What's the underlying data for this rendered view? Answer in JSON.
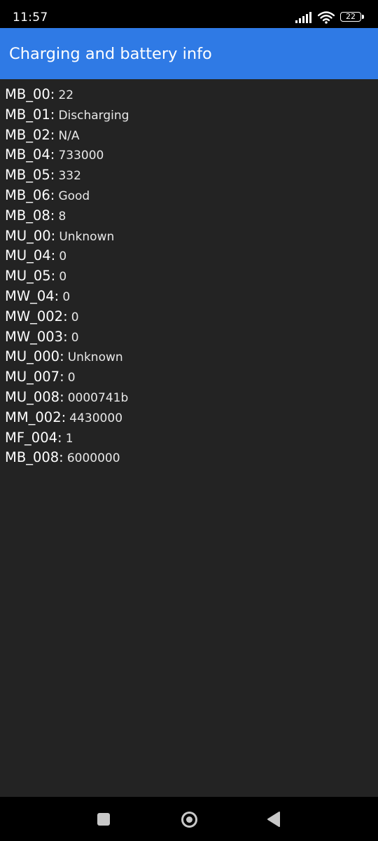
{
  "status_bar": {
    "time": "11:57",
    "battery_level": "22",
    "icons": [
      "signal-icon",
      "wifi-icon",
      "battery-icon"
    ]
  },
  "app_bar": {
    "title": "Charging and battery info",
    "color": "#2f7ae5"
  },
  "info": {
    "items": [
      {
        "key": "MB_00:",
        "value": "22"
      },
      {
        "key": "MB_01:",
        "value": "Discharging"
      },
      {
        "key": "MB_02:",
        "value": "N/A"
      },
      {
        "key": "MB_04:",
        "value": "733000"
      },
      {
        "key": "MB_05:",
        "value": "332"
      },
      {
        "key": "MB_06:",
        "value": "Good"
      },
      {
        "key": "MB_08:",
        "value": "8"
      },
      {
        "key": "MU_00:",
        "value": "Unknown"
      },
      {
        "key": "MU_04:",
        "value": "0"
      },
      {
        "key": "MU_05:",
        "value": "0"
      },
      {
        "key": "MW_04:",
        "value": "0"
      },
      {
        "key": "MW_002:",
        "value": "0"
      },
      {
        "key": "MW_003:",
        "value": "0"
      },
      {
        "key": "MU_000:",
        "value": "Unknown"
      },
      {
        "key": "MU_007:",
        "value": "0"
      },
      {
        "key": "MU_008:",
        "value": "0000741b"
      },
      {
        "key": "MM_002:",
        "value": "4430000"
      },
      {
        "key": "MF_004:",
        "value": "1"
      },
      {
        "key": "MB_008:",
        "value": "6000000"
      }
    ]
  },
  "nav_bar": {
    "buttons": [
      "recents-icon",
      "home-icon",
      "back-icon"
    ]
  }
}
